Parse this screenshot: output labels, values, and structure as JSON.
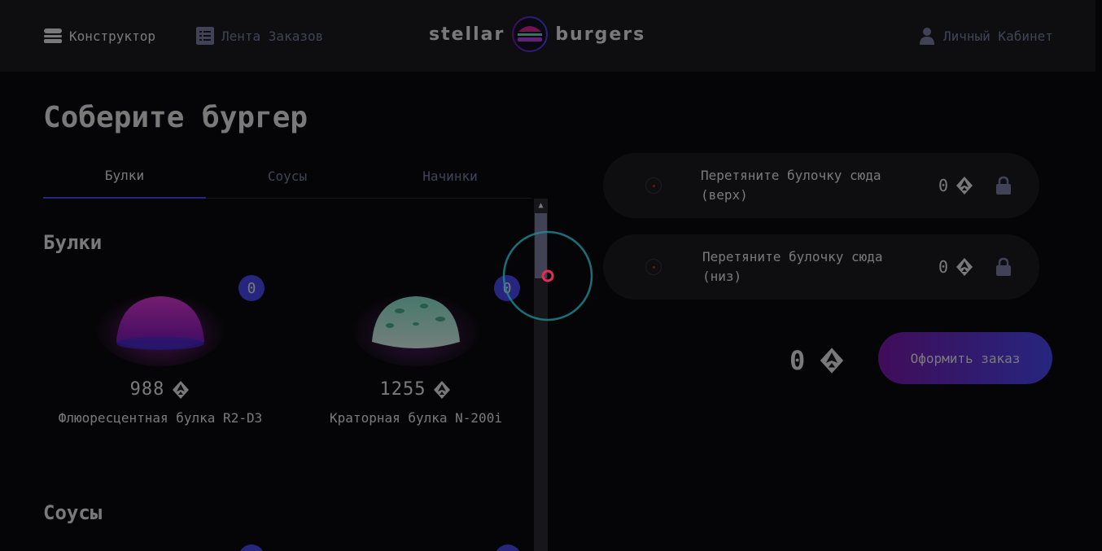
{
  "header": {
    "constructor_label": "Конструктор",
    "feed_label": "Лента Заказов",
    "logo_left": "stellar",
    "logo_right": "burgers",
    "account_label": "Личный Кабинет"
  },
  "main": {
    "title": "Соберите бургер",
    "tabs": [
      {
        "label": "Булки",
        "active": true
      },
      {
        "label": "Соусы",
        "active": false
      },
      {
        "label": "Начинки",
        "active": false
      }
    ],
    "sections": {
      "buns": {
        "title": "Булки",
        "items": [
          {
            "name": "Флюоресцентная булка R2-D3",
            "price": "988",
            "count": "0"
          },
          {
            "name": "Краторная булка N-200i",
            "price": "1255",
            "count": "0"
          }
        ]
      },
      "sauces": {
        "title": "Соусы"
      }
    }
  },
  "constructor": {
    "top_slot": {
      "text": "Перетяните булочку сюда (верх)",
      "price": "0"
    },
    "bottom_slot": {
      "text": "Перетяните булочку сюда (низ)",
      "price": "0"
    },
    "total": "0",
    "order_button": "Оформить заказ"
  },
  "colors": {
    "accent": "#4c4cff",
    "gradient_start": "#801ab3",
    "inactive_text": "#8585ad",
    "panel": "#1c1c21"
  },
  "icons": [
    "burger-icon",
    "list-icon",
    "profile-icon",
    "currency-icon",
    "lock-icon",
    "drag-icon",
    "loader-icon"
  ]
}
